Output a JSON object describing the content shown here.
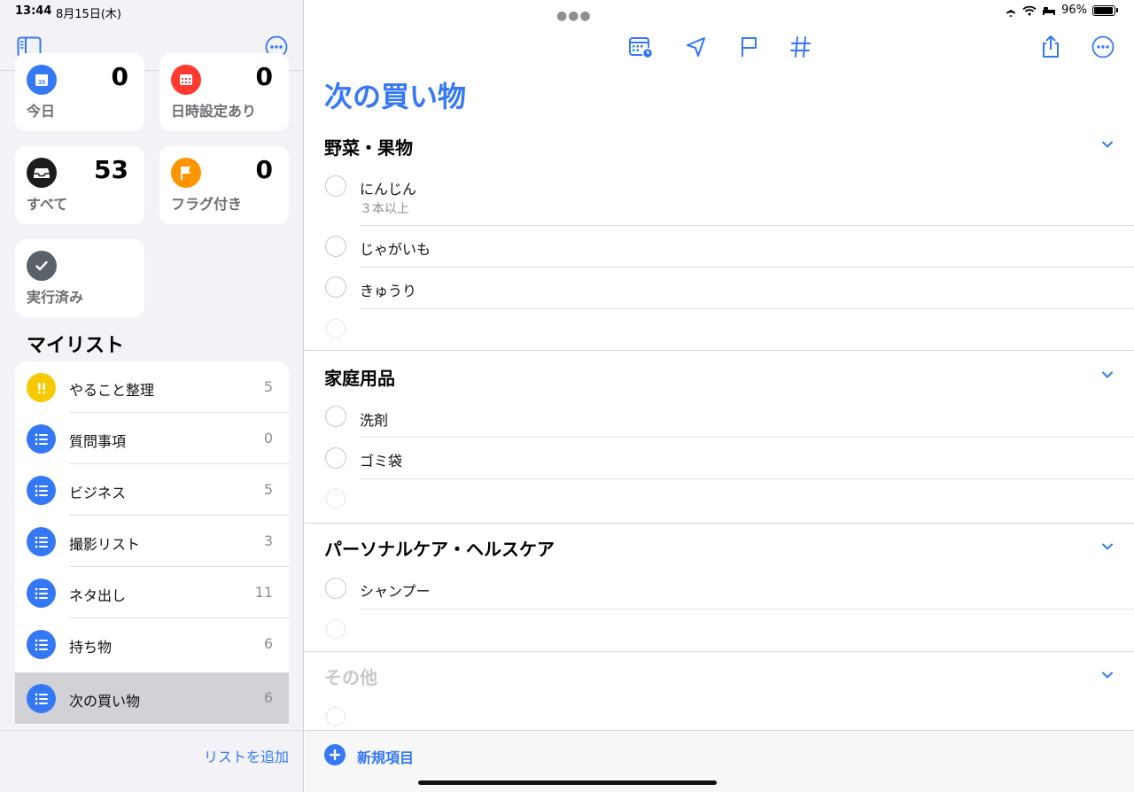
{
  "status": {
    "time": "13:44",
    "date": "8月15日(木)",
    "battery": "96%"
  },
  "smart_lists": [
    {
      "id": "today",
      "label": "今日",
      "count": "0",
      "color": "#3478f6",
      "icon": "calendar-icon"
    },
    {
      "id": "scheduled",
      "label": "日時設定あり",
      "count": "0",
      "color": "#ff3b30",
      "icon": "calendar-grid-icon"
    },
    {
      "id": "all",
      "label": "すべて",
      "count": "53",
      "color": "#1c1c1e",
      "icon": "tray-icon"
    },
    {
      "id": "flagged",
      "label": "フラグ付き",
      "count": "0",
      "color": "#ff9500",
      "icon": "flag-icon"
    },
    {
      "id": "completed",
      "label": "実行済み",
      "color": "#5a6168",
      "icon": "checkmark-icon"
    }
  ],
  "my_lists_title": "マイリスト",
  "my_lists": [
    {
      "name": "やること整理",
      "count": "5",
      "color": "#f7c900",
      "icon": "exclamation-icon"
    },
    {
      "name": "質問事項",
      "count": "0",
      "color": "#3478f6",
      "icon": "list-icon"
    },
    {
      "name": "ビジネス",
      "count": "5",
      "color": "#3478f6",
      "icon": "list-icon"
    },
    {
      "name": "撮影リスト",
      "count": "3",
      "color": "#3478f6",
      "icon": "list-icon"
    },
    {
      "name": "ネタ出し",
      "count": "11",
      "color": "#3478f6",
      "icon": "list-icon"
    },
    {
      "name": "持ち物",
      "count": "6",
      "color": "#3478f6",
      "icon": "list-icon"
    },
    {
      "name": "次の買い物",
      "count": "6",
      "color": "#3478f6",
      "icon": "list-icon",
      "selected": true
    }
  ],
  "add_list_label": "リストを追加",
  "main": {
    "title": "次の買い物",
    "accent": "#3478f6",
    "sections": [
      {
        "title": "野菜・果物",
        "items": [
          {
            "name": "にんじん",
            "note": "３本以上"
          },
          {
            "name": "じゃがいも"
          },
          {
            "name": "きゅうり"
          }
        ]
      },
      {
        "title": "家庭用品",
        "items": [
          {
            "name": "洗剤"
          },
          {
            "name": "ゴミ袋"
          }
        ]
      },
      {
        "title": "パーソナルケア・ヘルスケア",
        "items": [
          {
            "name": "シャンプー"
          }
        ]
      },
      {
        "title": "その他",
        "items": [],
        "muted": true
      }
    ],
    "new_item_label": "新規項目"
  }
}
